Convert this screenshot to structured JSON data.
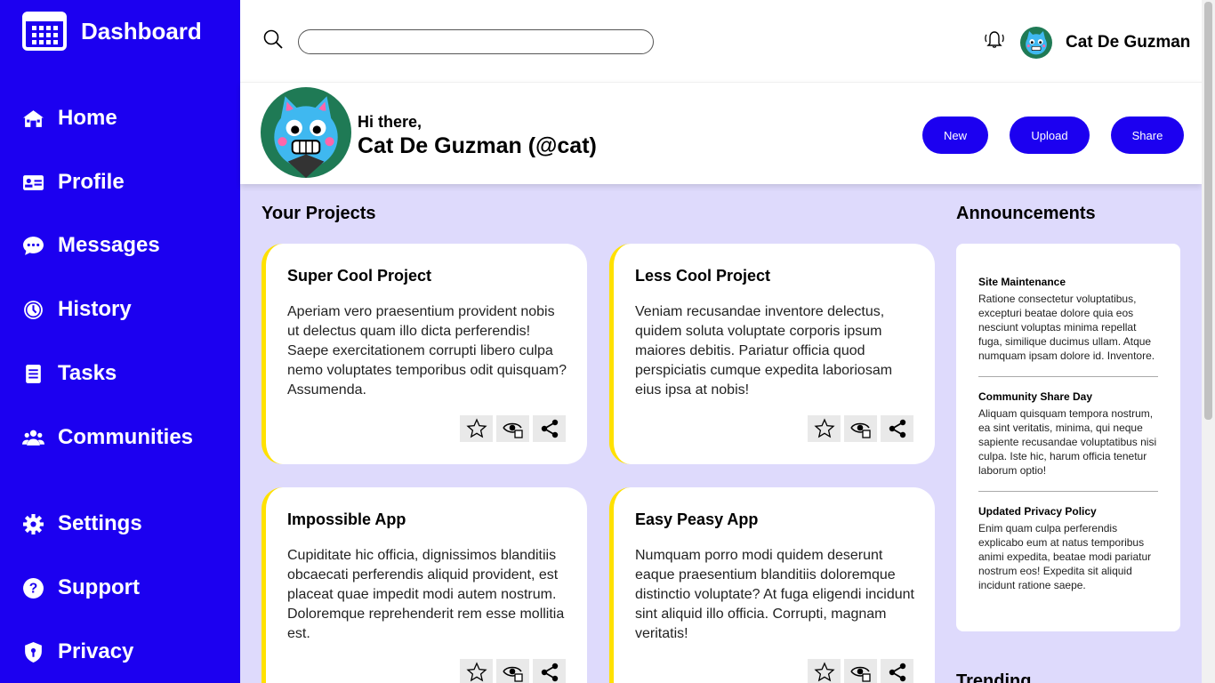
{
  "sidebar": {
    "brand": "Dashboard",
    "items": [
      {
        "label": "Home",
        "icon": "home-icon"
      },
      {
        "label": "Profile",
        "icon": "id-card-icon"
      },
      {
        "label": "Messages",
        "icon": "chat-icon"
      },
      {
        "label": "History",
        "icon": "clock-icon"
      },
      {
        "label": "Tasks",
        "icon": "clipboard-icon"
      },
      {
        "label": "Communities",
        "icon": "people-icon"
      },
      {
        "label": "Settings",
        "icon": "gear-icon"
      },
      {
        "label": "Support",
        "icon": "help-icon"
      },
      {
        "label": "Privacy",
        "icon": "shield-icon"
      }
    ]
  },
  "topbar": {
    "search_value": "",
    "user_name": "Cat De Guzman"
  },
  "header": {
    "greeting": "Hi there,",
    "name": "Cat De Guzman (@cat)",
    "buttons": [
      "New",
      "Upload",
      "Share"
    ]
  },
  "projects": {
    "title": "Your Projects",
    "cards": [
      {
        "title": "Super Cool Project",
        "description": "Aperiam vero praesentium provident nobis ut delectus quam illo dicta perferendis! Saepe exercitationem corrupti libero culpa nemo voluptates temporibus odit quisquam? Assumenda."
      },
      {
        "title": "Less Cool Project",
        "description": "Veniam recusandae inventore delectus, quidem soluta voluptate corporis ipsum maiores debitis. Pariatur officia quod perspiciatis cumque expedita laboriosam eius ipsa at nobis!"
      },
      {
        "title": "Impossible App",
        "description": "Cupiditate hic officia, dignissimos blanditiis obcaecati perferendis aliquid provident, est placeat quae impedit modi autem nostrum. Doloremque reprehenderit rem esse mollitia est."
      },
      {
        "title": "Easy Peasy App",
        "description": "Numquam porro modi quidem deserunt eaque praesentium blanditiis doloremque distinctio voluptate? At fuga eligendi incidunt sint aliquid illo officia. Corrupti, magnam veritatis!"
      }
    ]
  },
  "announcements": {
    "title": "Announcements",
    "items": [
      {
        "title": "Site Maintenance",
        "body": "Ratione consectetur voluptatibus, excepturi beatae dolore quia eos nesciunt voluptas minima repellat fuga, similique ducimus ullam. Atque numquam ipsam dolore id. Inventore."
      },
      {
        "title": "Community Share Day",
        "body": "Aliquam quisquam tempora nostrum, ea sint veritatis, minima, qui neque sapiente recusandae voluptatibus nisi culpa. Iste hic, harum officia tenetur laborum optio!"
      },
      {
        "title": "Updated Privacy Policy",
        "body": "Enim quam culpa perferendis explicabo eum at natus temporibus animi expedita, beatae modi pariatur nostrum eos! Expedita sit aliquid incidunt ratione saepe."
      }
    ]
  },
  "trending": {
    "title": "Trending"
  },
  "colors": {
    "primary": "#1c00f0",
    "background": "#dedafc",
    "card_accent": "#ffe100"
  }
}
